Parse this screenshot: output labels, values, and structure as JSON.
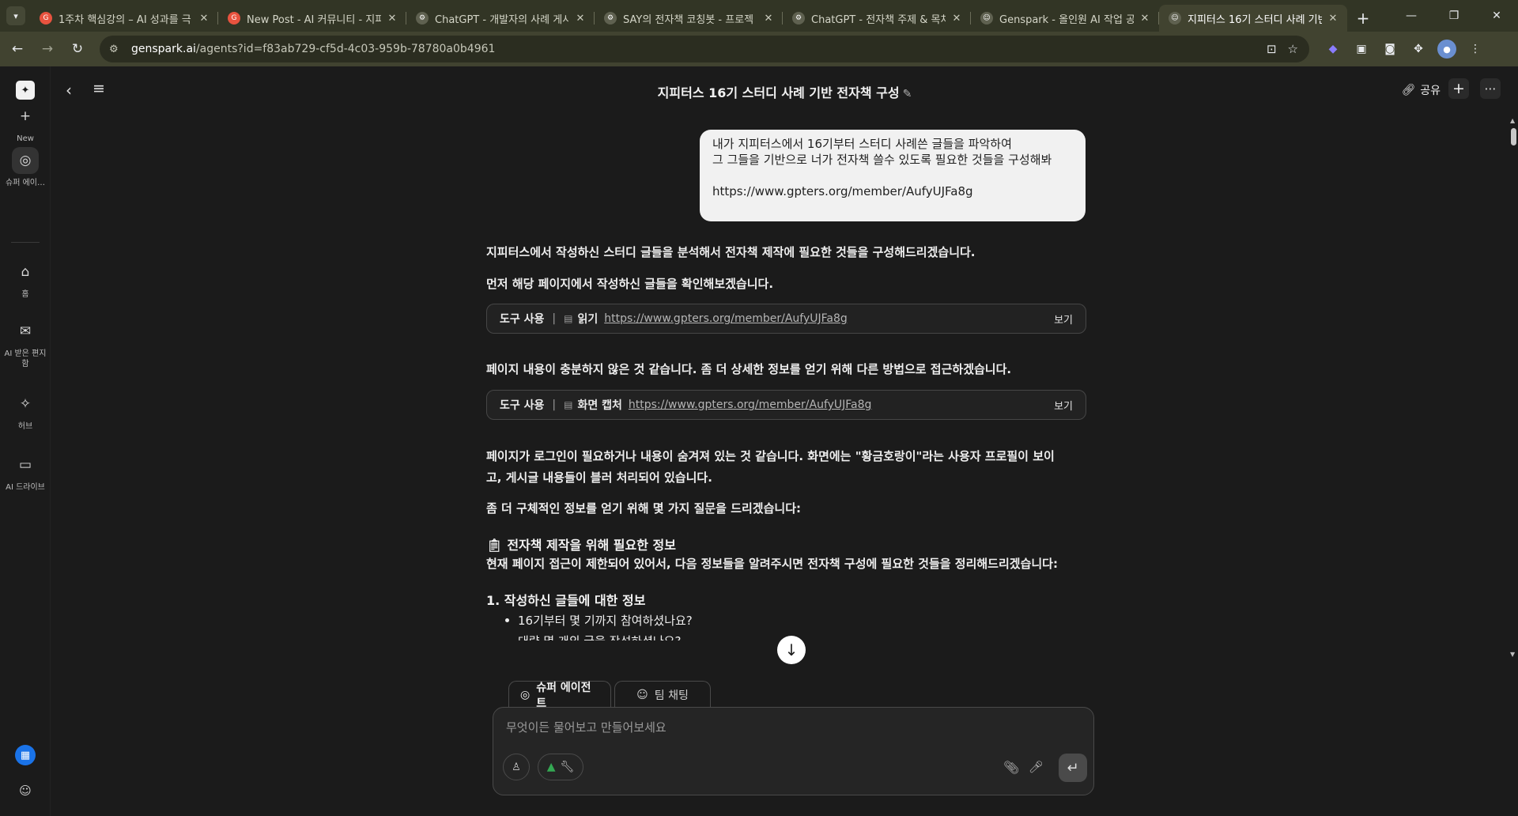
{
  "browser": {
    "tabs": [
      {
        "title": "1주차 핵심강의 – AI 성과를 극",
        "favicon": "gpters-icon",
        "color": "#e8533f"
      },
      {
        "title": "New Post - AI 커뮤니티 - 지피",
        "favicon": "gpters-icon",
        "color": "#e8533f"
      },
      {
        "title": "ChatGPT - 개발자의 사례 게시",
        "favicon": "chatgpt-icon",
        "color": "#5f6150"
      },
      {
        "title": "SAY의 전자책 코칭봇 - 프로젝",
        "favicon": "chatgpt-icon",
        "color": "#5f6150"
      },
      {
        "title": "ChatGPT - 전자책 주제 & 목차",
        "favicon": "chatgpt-icon",
        "color": "#5f6150"
      },
      {
        "title": "Genspark - 올인원 AI 작업 공",
        "favicon": "genspark-icon",
        "color": "#5f6150"
      },
      {
        "title": "지피터스 16기 스터디 사례 기반",
        "favicon": "genspark-icon",
        "color": "#5f6150",
        "active": true
      }
    ],
    "url_host": "genspark.ai",
    "url_path": "/agents?id=f83ab729-cf5d-4c03-959b-78780a0b4961"
  },
  "sidebar": {
    "new_label": "New",
    "super_agent_label": "슈퍼 에이…",
    "home_label": "홈",
    "inbox_label": "AI 받은 편지함",
    "hub_label": "허브",
    "drive_label": "AI 드라이브"
  },
  "header": {
    "title": "지피터스 16기 스터디 사례 기반 전자책 구성",
    "share_label": "공유"
  },
  "chat": {
    "user_message": {
      "line1": "내가 지피터스에서 16기부터 스터디 사례쓴 글들을 파악하여",
      "line2": "그 그들을 기반으로 너가 전자책 쓸수 있도록 필요한 것들을 구성해봐",
      "link": "https://www.gpters.org/member/AufyUJFa8g"
    },
    "p1": "지피터스에서 작성하신 스터디 글들을 분석해서 전자책 제작에 필요한 것들을 구성해드리겠습니다.",
    "p2": "먼저 해당 페이지에서 작성하신 글들을 확인해보겠습니다.",
    "tool1": {
      "label": "도구 사용",
      "action": "읽기",
      "url": "https://www.gpters.org/member/AufyUJFa8g",
      "view": "보기"
    },
    "p3": "페이지 내용이 충분하지 않은 것 같습니다. 좀 더 상세한 정보를 얻기 위해 다른 방법으로 접근하겠습니다.",
    "tool2": {
      "label": "도구 사용",
      "action": "화면 캡처",
      "url": "https://www.gpters.org/member/AufyUJFa8g",
      "view": "보기"
    },
    "p4a": "페이지가 로그인이 필요하거나 내용이 숨겨져 있는 것 같습니다. 화면에는 \"황금호랑이\"라는 사용자 프로필이 보이",
    "p4b": "고, 게시글 내용들이 블러 처리되어 있습니다.",
    "p5": "좀 더 구체적인 정보를 얻기 위해 몇 가지 질문을 드리겠습니다:",
    "h_info": "전자책 제작을 위해 필요한 정보",
    "p6": "현재 페이지 접근이 제한되어 있어서, 다음 정보들을 알려주시면 전자책 구성에 필요한 것들을 정리해드리겠습니다:",
    "h_section1": "1. 작성하신 글들에 대한 정보",
    "bullets": [
      "16기부터 몇 기까지 참여하셨나요?",
      "대략 몇 개의 글을 작성하셨나요?"
    ]
  },
  "composer": {
    "tab_agent": "슈퍼 에이전트",
    "tab_team": "팀 채팅",
    "placeholder": "무엇이든 물어보고 만들어보세요"
  }
}
